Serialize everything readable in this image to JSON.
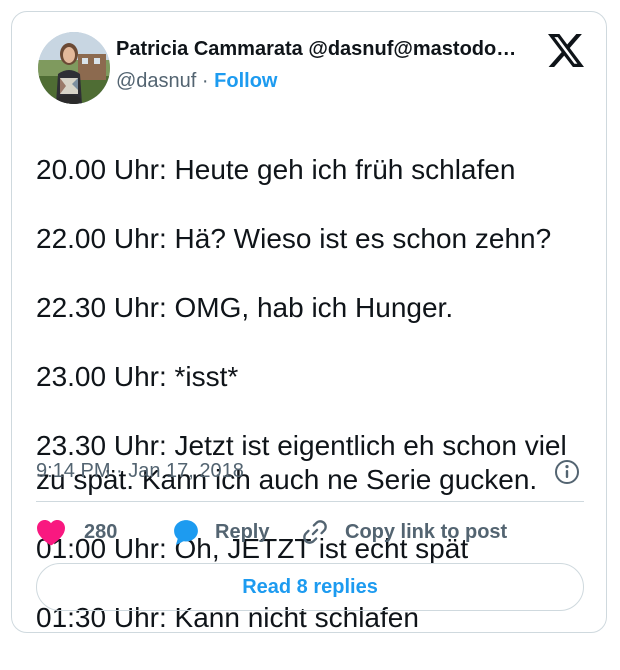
{
  "author": {
    "name": "Patricia Cammarata @dasnuf@mastodo…",
    "handle": "@dasnuf",
    "separator": "·",
    "follow_label": "Follow"
  },
  "tweet": {
    "lines": [
      "20.00 Uhr: Heute geh ich früh schlafen",
      "22.00 Uhr: Hä? Wieso ist es schon zehn?",
      "22.30 Uhr: OMG, hab ich Hunger.",
      "23.00 Uhr: *isst*",
      "23.30 Uhr: Jetzt ist eigentlich eh schon viel zu spät. Kann ich auch ne Serie gucken.",
      "01:00 Uhr: Oh, JETZT ist echt spät",
      "01:30 Uhr: Kann nicht schlafen"
    ],
    "timestamp": "9:14 PM · Jan 17, 2018"
  },
  "actions": {
    "like_count": "280",
    "reply_label": "Reply",
    "copy_link_label": "Copy link to post"
  },
  "footer": {
    "read_replies_label": "Read 8 replies"
  },
  "icons": {
    "platform": "x-logo-icon",
    "info": "info-icon",
    "like": "heart-icon",
    "reply": "speech-bubble-icon",
    "copy_link": "link-icon"
  },
  "colors": {
    "accent": "#1d9bf0",
    "like": "#f91880",
    "text": "#0f1419",
    "secondary": "#536471",
    "border": "#cfd9de"
  }
}
